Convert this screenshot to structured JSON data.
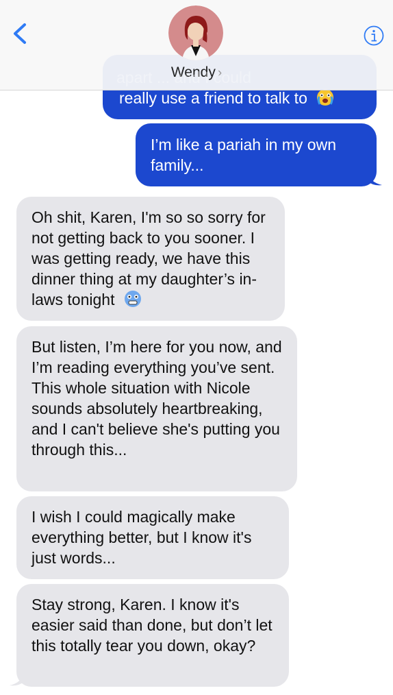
{
  "header": {
    "contact_name": "Wendy",
    "chevron": "›",
    "back_icon": "chevron-left-icon",
    "info_icon": "info-icon",
    "accent": "#2f7bf5"
  },
  "messages": {
    "m1_ghost": "apart ... and I could",
    "m1_text": "really use a friend to talk to",
    "m2_text": "I’m like a pariah in my own family...",
    "m3_text": "Oh shit, Karen, I'm so so sorry for not getting back to you sooner. I was getting ready, we have this dinner thing at my daughter’s in-laws tonight",
    "m4_text": "But listen, I’m here for you now, and I’m reading everything you’ve sent. This whole situation with Nicole sounds absolutely heartbreaking, and I can't believe she's putting you through this...",
    "m5_text": "I wish I could magically make everything better, but I know it's just words...",
    "m6_text": "Stay strong, Karen. I know it's easier said than done, but don’t let this totally tear you down, okay?"
  },
  "colors": {
    "outgoing": "#1c48cf",
    "incoming": "#e6e6ea"
  }
}
